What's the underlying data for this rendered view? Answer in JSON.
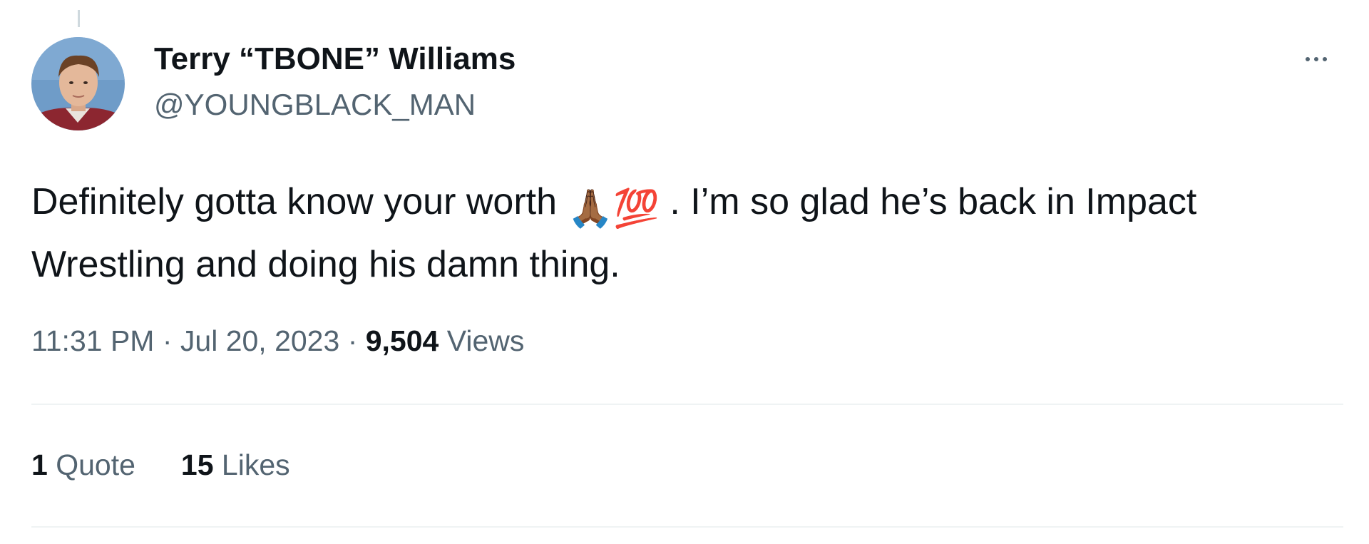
{
  "author": {
    "display_name": "Terry “TBONE” Williams",
    "handle": "@YOUNGBLACK_MAN",
    "avatar_icon": "profile-photo-avatar"
  },
  "tweet": {
    "text_part1": "Definitely gotta know your worth ",
    "emoji_1": "🙏🏾",
    "emoji_2": "💯",
    "text_part2": " . I’m so glad he’s back in Impact Wrestling and doing his damn thing.",
    "time": "11:31 PM",
    "sep1": " · ",
    "date": "Jul 20, 2023",
    "sep2": " · ",
    "views_count": "9,504",
    "views_label": " Views"
  },
  "stats": {
    "quotes_count": "1",
    "quotes_label": " Quote",
    "likes_count": "15",
    "likes_label": " Likes"
  },
  "icons": {
    "more": "more-horizontal-icon"
  },
  "colors": {
    "primary_text": "#0f1419",
    "secondary_text": "#536471",
    "divider": "#eff3f4"
  }
}
